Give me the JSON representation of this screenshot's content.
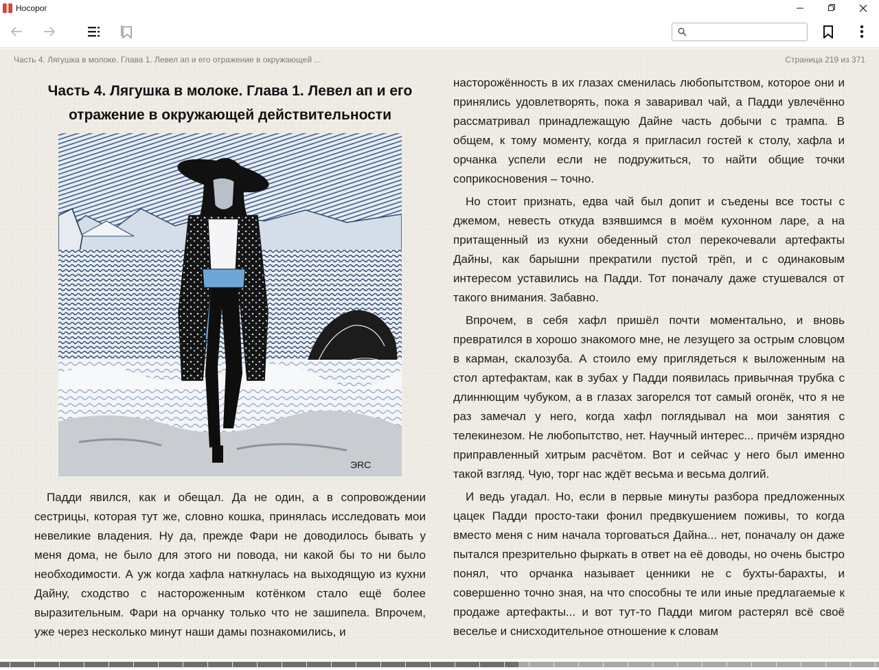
{
  "window": {
    "title": "Носорог",
    "minimize_glyph": "—",
    "maximize_glyph": "❐",
    "close_glyph": "✕"
  },
  "toolbar": {
    "back_icon": "arrow-left-icon",
    "forward_icon": "arrow-right-icon",
    "contents_icon": "table-of-contents-icon",
    "bookmarks_list_icon": "bookmarks-list-icon",
    "search_placeholder": "",
    "search_value": "",
    "bookmark_icon": "bookmark-icon",
    "menu_icon": "more-vertical-icon"
  },
  "reader": {
    "running_head": "Часть 4. Лягушка в молоке. Глава 1. Левел ап и его отражение в окружающей ...",
    "page_indicator": "Страница 219 из 371",
    "chapter_title": "Часть 4. Лягушка в молоке. Глава 1. Левел ап и его отражение в окружающей действительности",
    "illustration_signature": "ЭRС",
    "left_paragraphs": [
      "Падди явился, как и обещал. Да не один, а в сопровождении сестрицы, которая тут же, словно кошка, принялась исследовать мои невеликие владения. Ну да, прежде Фари не доводилось бывать у меня дома, не было для этого ни повода, ни какой бы то ни было необходимости. А уж когда хафла наткнулась на выходящую из кухни Дайну, сходство с настороженным котёнком стало ещё более выразительным. Фари на орчанку только что не зашипела. Впрочем, уже через несколько минут наши дамы познакомились, и"
    ],
    "right_paragraphs": [
      "насторожённость в их глазах сменилась любопытством, которое они и принялись удовлетворять, пока я заваривал чай, а Падди увлечённо рассматривал принадлежащую Дайне часть добычи с трампа. В общем, к тому моменту, когда я пригласил гостей к столу, хафла и орчанка успели если не подружиться, то найти общие точки соприкосновения – точно.",
      "Но стоит признать, едва чай был допит и съедены все тосты с джемом, невесть откуда взявшимся в моём кухонном ларе, а на притащенный из кухни обеденный стол перекочевали артефакты Дайны, как барышни прекратили пустой трёп, и с одинаковым интересом уставились на Падди. Тот поначалу даже стушевался от такого внимания. Забавно.",
      "Впрочем, в себя хафл пришёл почти моментально, и вновь превратился в хорошо знакомого мне, не лезущего за острым словцом в карман, скалозуба. А стоило ему приглядеться к выложенным на стол артефактам, как в зубах у Падди появилась привычная трубка с длиннющим чубуком, а в глазах загорелся тот самый огонёк, что я не раз замечал у него, когда хафл поглядывал на мои занятия с телекинезом. Не любопытство, нет. Научный интерес... причём изрядно приправленный хитрым расчётом. Вот и сейчас у него был именно такой взгляд. Чую, торг нас ждёт весьма и весьма долгий.",
      "И ведь угадал. Но, если в первые минуты разбора предложенных цацек Падди просто-таки фонил предвкушением поживы, то когда вместо меня с ним начала торговаться Дайна... нет, поначалу он даже пытался презрительно фыркать в ответ на её доводы, но очень быстро понял, что орчанка называет ценники не с бухты-барахты, и совершенно точно зная, на что способны те или иные предлагаемые к продаже артефакты... и вот тут-то Падди мигом растерял всё своё веселье и снисходительное отношение к словам"
    ]
  },
  "progress": {
    "current_page": 219,
    "total_pages": 371,
    "fraction": 0.59
  },
  "colors": {
    "page_background": "#efece5",
    "text": "#1c1c1c",
    "muted_text": "#7d7a74",
    "ink_blue": "#2f4a72",
    "sash_blue": "#6ea6d8"
  }
}
